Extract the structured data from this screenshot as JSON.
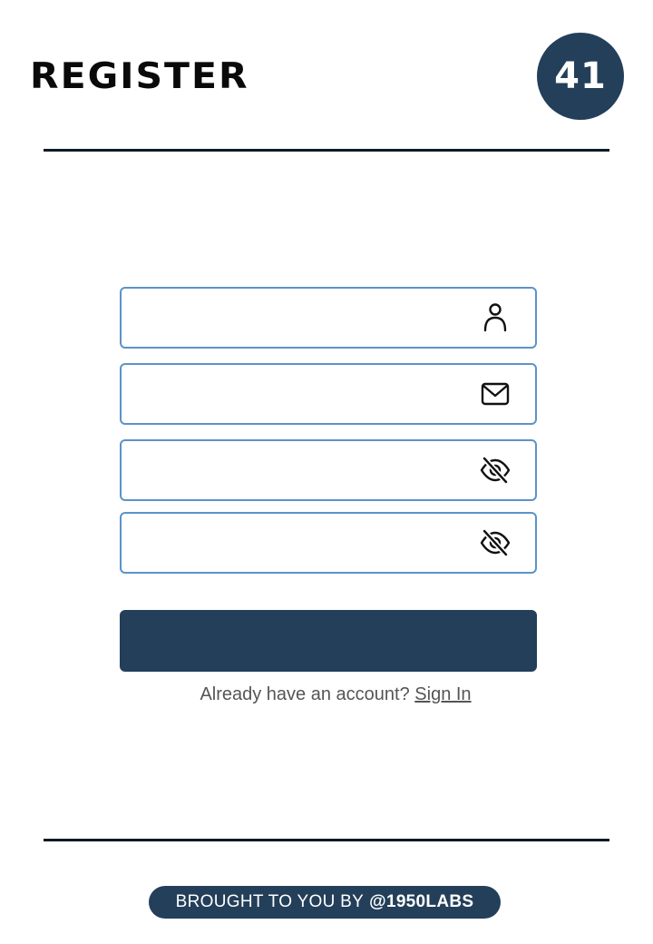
{
  "header": {
    "title": "REGISTER",
    "badge": "41"
  },
  "form": {
    "fields": [
      {
        "name": "username",
        "value": "",
        "placeholder": "",
        "icon": "user-icon"
      },
      {
        "name": "email",
        "value": "",
        "placeholder": "",
        "icon": "mail-icon"
      },
      {
        "name": "password",
        "value": "",
        "placeholder": "",
        "icon": "eye-off-icon"
      },
      {
        "name": "confirm_password",
        "value": "",
        "placeholder": "",
        "icon": "eye-off-icon"
      }
    ],
    "submit_label": ""
  },
  "signin": {
    "prompt": "Already have an account?",
    "link_label": "Sign In"
  },
  "footer": {
    "credit_prefix": "BROUGHT TO YOU BY",
    "credit_handle": "@1950LABS"
  },
  "colors": {
    "accent": "#233f5a",
    "field_border": "#5b93c9",
    "rule": "#0e1a26"
  }
}
